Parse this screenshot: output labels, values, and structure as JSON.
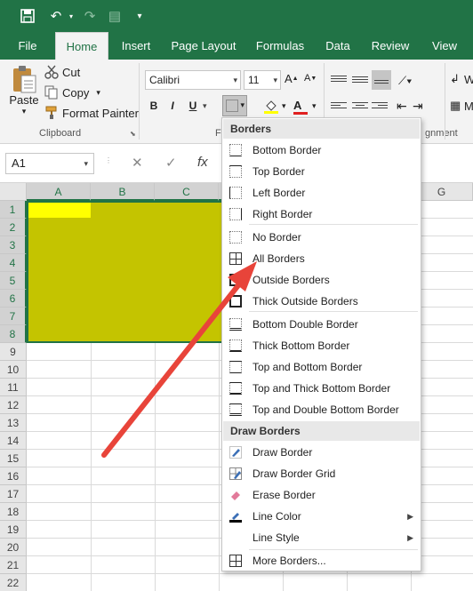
{
  "qat": {
    "save": "save-icon",
    "undo": "undo-icon",
    "redo": "redo-icon",
    "more": "customize-icon"
  },
  "tabs": [
    "File",
    "Home",
    "Insert",
    "Page Layout",
    "Formulas",
    "Data",
    "Review",
    "View"
  ],
  "active_tab": "Home",
  "clipboard": {
    "paste_label": "Paste",
    "cut_label": "Cut",
    "copy_label": "Copy",
    "format_painter_label": "Format Painter",
    "group_label": "Clipboard"
  },
  "font": {
    "family": "Calibri",
    "size": "11",
    "bold": "B",
    "italic": "I",
    "underline": "U",
    "group_label": "Fo"
  },
  "alignment": {
    "group_label": "gnment",
    "wrap_partial": "W",
    "merge_partial": "M"
  },
  "formula_bar": {
    "name_box": "A1",
    "cancel": "✕",
    "enter": "✓",
    "fx": "fx"
  },
  "columns": [
    "A",
    "B",
    "C",
    "",
    "",
    "",
    "G"
  ],
  "rows": [
    "1",
    "2",
    "3",
    "4",
    "5",
    "6",
    "7",
    "8",
    "9",
    "10",
    "11",
    "12",
    "13",
    "14",
    "15",
    "16",
    "17",
    "18",
    "19",
    "20",
    "21",
    "22"
  ],
  "colors": {
    "excel_green": "#217346",
    "range_fill": "#c4c400",
    "a1_fill": "#ffff00",
    "arrow": "#e8443a"
  },
  "menu": {
    "borders_header": "Borders",
    "items_borders": [
      "Bottom Border",
      "Top Border",
      "Left Border",
      "Right Border",
      "No Border",
      "All Borders",
      "Outside Borders",
      "Thick Outside Borders",
      "Bottom Double Border",
      "Thick Bottom Border",
      "Top and Bottom Border",
      "Top and Thick Bottom Border",
      "Top and Double Bottom Border"
    ],
    "draw_header": "Draw Borders",
    "items_draw": [
      "Draw Border",
      "Draw Border Grid",
      "Erase Border",
      "Line Color",
      "Line Style"
    ],
    "more": "More Borders..."
  }
}
